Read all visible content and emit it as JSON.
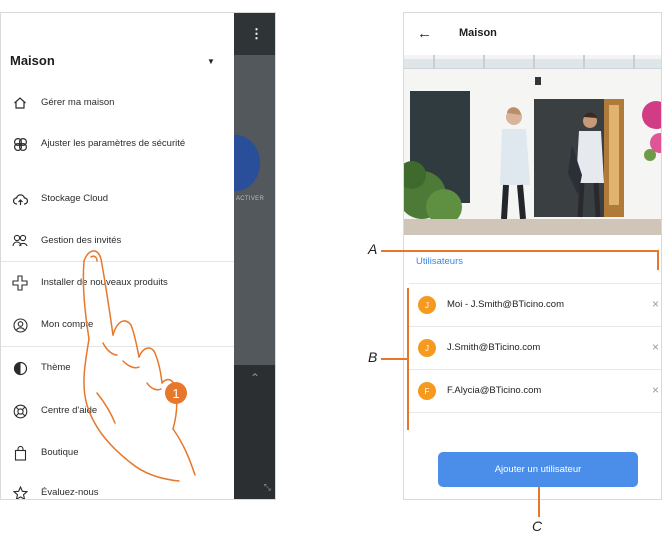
{
  "left_screen": {
    "drawer_title": "Maison",
    "kebab": "⋮",
    "activer_text": "ACTIVER",
    "menu": [
      {
        "label": "Gérer ma maison",
        "icon": "home-icon"
      },
      {
        "label": "Ajuster les paramètres de sécurité",
        "icon": "security-settings-icon"
      },
      {
        "label": "Stockage Cloud",
        "icon": "cloud-upload-icon"
      },
      {
        "label": "Gestion des invités",
        "icon": "guests-icon"
      },
      {
        "label": "Installer de nouveaux produits",
        "icon": "add-product-icon"
      },
      {
        "label": "Mon compte",
        "icon": "account-icon"
      },
      {
        "label": "Thème",
        "icon": "theme-icon"
      },
      {
        "label": "Centre d'aide",
        "icon": "help-center-icon"
      },
      {
        "label": "Boutique",
        "icon": "shop-bag-icon"
      },
      {
        "label": "Évaluez-nous",
        "icon": "star-icon"
      }
    ],
    "step_number": "1"
  },
  "right_screen": {
    "title": "Maison",
    "section_label": "Utilisateurs",
    "users": [
      {
        "initial": "J",
        "email": "Moi - J.Smith@BTicino.com"
      },
      {
        "initial": "J",
        "email": "J.Smith@BTicino.com"
      },
      {
        "initial": "F",
        "email": "F.Alycia@BTicino.com"
      }
    ],
    "add_button": "Ajouter un utilisateur"
  },
  "callouts": {
    "a": "A",
    "b": "B",
    "c": "C"
  },
  "colors": {
    "accent_orange": "#e7772a",
    "avatar_orange": "#f59a1e",
    "button_blue": "#4a8ee9",
    "link_blue": "#3a86e8"
  }
}
